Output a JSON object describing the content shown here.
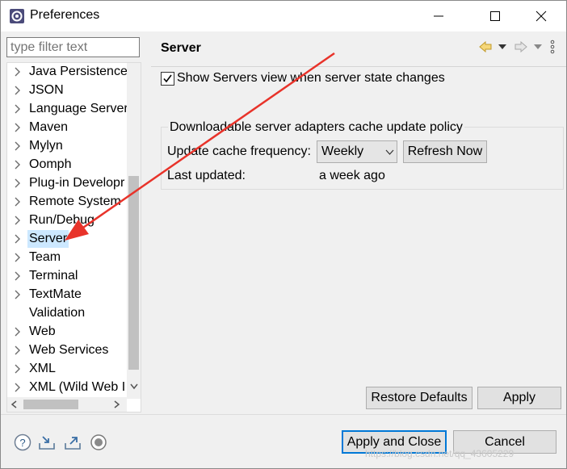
{
  "window": {
    "title": "Preferences"
  },
  "filter": {
    "placeholder": "type filter text"
  },
  "tree": {
    "items": [
      {
        "label": "Java Persistence",
        "expandable": true
      },
      {
        "label": "JSON",
        "expandable": true
      },
      {
        "label": "Language Server",
        "expandable": true
      },
      {
        "label": "Maven",
        "expandable": true
      },
      {
        "label": "Mylyn",
        "expandable": true
      },
      {
        "label": "Oomph",
        "expandable": true
      },
      {
        "label": "Plug-in Developr",
        "expandable": true
      },
      {
        "label": "Remote System",
        "expandable": true
      },
      {
        "label": "Run/Debug",
        "expandable": true
      },
      {
        "label": "Server",
        "expandable": true,
        "selected": true
      },
      {
        "label": "Team",
        "expandable": true
      },
      {
        "label": "Terminal",
        "expandable": true
      },
      {
        "label": "TextMate",
        "expandable": true
      },
      {
        "label": "Validation",
        "expandable": false
      },
      {
        "label": "Web",
        "expandable": true
      },
      {
        "label": "Web Services",
        "expandable": true
      },
      {
        "label": "XML",
        "expandable": true
      },
      {
        "label": "XML (Wild Web I",
        "expandable": true
      }
    ]
  },
  "page": {
    "title": "Server",
    "show_servers_label": "Show Servers view when server state changes",
    "show_servers_checked": true,
    "group": {
      "title": "Downloadable server adapters cache update policy",
      "frequency_label": "Update cache frequency:",
      "frequency_value": "Weekly",
      "refresh_label": "Refresh Now",
      "last_updated_label": "Last updated:",
      "last_updated_value": "a week ago"
    },
    "restore_defaults_label": "Restore Defaults",
    "apply_label": "Apply"
  },
  "footer": {
    "apply_close_label": "Apply and Close",
    "cancel_label": "Cancel"
  },
  "watermark": "https://blog.csdn.net/qq_43605229",
  "colors": {
    "selection": "#cce8ff",
    "accent": "#0078d7",
    "annotation_arrow": "#e8332a"
  }
}
